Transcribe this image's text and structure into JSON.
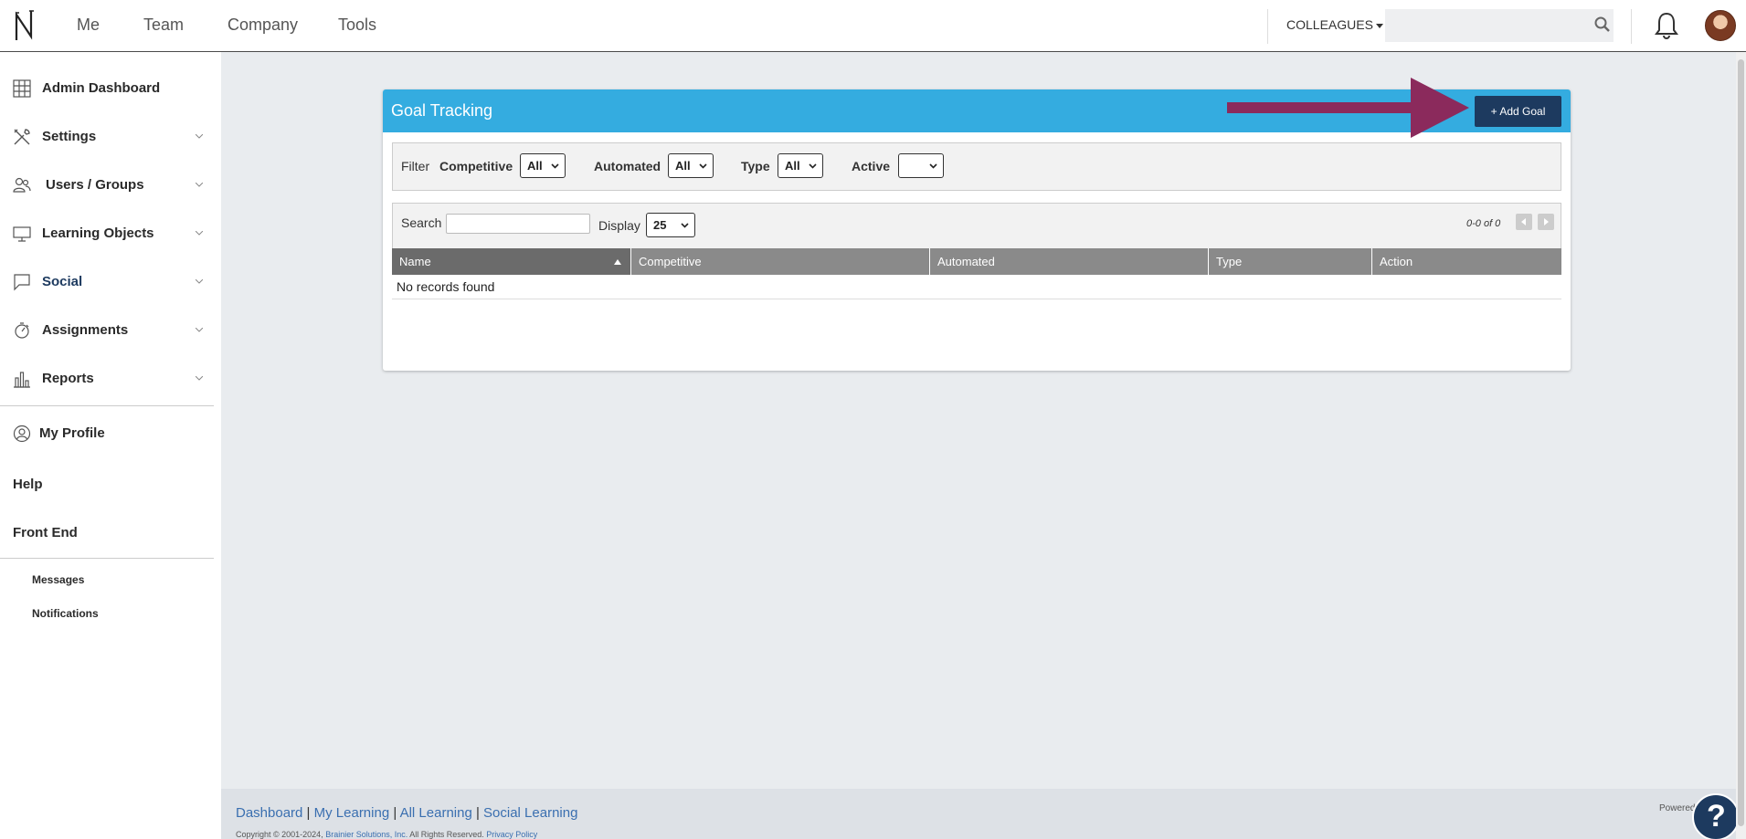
{
  "topnav": {
    "items": [
      "Me",
      "Team",
      "Company",
      "Tools"
    ],
    "colleagues_label": "COLLEAGUES",
    "search_placeholder": ""
  },
  "sidebar": {
    "items": [
      {
        "label": "Admin Dashboard",
        "icon": "grid-icon"
      },
      {
        "label": "Settings",
        "icon": "tools-icon"
      },
      {
        "label": "Users / Groups",
        "icon": "users-icon"
      },
      {
        "label": "Learning Objects",
        "icon": "monitor-icon"
      },
      {
        "label": "Social",
        "icon": "chat-icon"
      },
      {
        "label": "Assignments",
        "icon": "stopwatch-icon"
      },
      {
        "label": "Reports",
        "icon": "bar-chart-icon"
      }
    ],
    "my_profile": "My Profile",
    "help": "Help",
    "front_end": "Front End",
    "messages": "Messages",
    "notifications": "Notifications"
  },
  "panel": {
    "title": "Goal Tracking",
    "add_button": "+ Add Goal",
    "filter": {
      "label": "Filter",
      "competitive_label": "Competitive",
      "competitive_value": "All",
      "automated_label": "Automated",
      "automated_value": "All",
      "type_label": "Type",
      "type_value": "All",
      "active_label": "Active",
      "active_value": ""
    },
    "search_label": "Search",
    "display_label": "Display",
    "display_value": "25",
    "pager_text": "0-0 of 0",
    "columns": [
      "Name",
      "Competitive",
      "Automated",
      "Type",
      "Action"
    ],
    "empty_text": "No records found"
  },
  "footer": {
    "links": [
      "Dashboard",
      "My Learning",
      "All Learning",
      "Social Learning"
    ],
    "separator": " | ",
    "copyright": "Copyright © 2001-2024, ",
    "company": "Brainier Solutions, Inc.",
    "rights": " All Rights Reserved. ",
    "privacy": "Privacy Policy",
    "powered": "Powered"
  },
  "colors": {
    "header_blue": "#34ace0",
    "button_navy": "#1d3a5f",
    "annotation_arrow": "#8b2a5c"
  }
}
